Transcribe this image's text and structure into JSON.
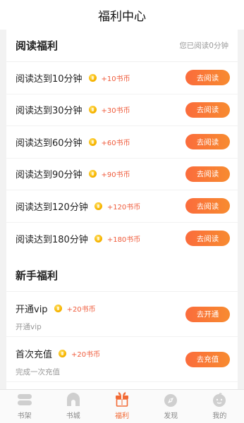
{
  "header": {
    "title": "福利中心"
  },
  "reading": {
    "title": "阅读福利",
    "note": "您已阅读0分钟",
    "items": [
      {
        "label": "阅读达到10分钟",
        "reward": "+10书币",
        "button": "去阅读"
      },
      {
        "label": "阅读达到30分钟",
        "reward": "+30书币",
        "button": "去阅读"
      },
      {
        "label": "阅读达到60分钟",
        "reward": "+60书币",
        "button": "去阅读"
      },
      {
        "label": "阅读达到90分钟",
        "reward": "+90书币",
        "button": "去阅读"
      },
      {
        "label": "阅读达到120分钟",
        "reward": "+120书币",
        "button": "去阅读"
      },
      {
        "label": "阅读达到180分钟",
        "reward": "+180书币",
        "button": "去阅读"
      }
    ]
  },
  "newbie": {
    "title": "新手福利",
    "items": [
      {
        "label": "开通vip",
        "reward": "+20书币",
        "sub": "开通vip",
        "button": "去开通"
      },
      {
        "label": "首次充值",
        "reward": "+20书币",
        "sub": "完成一次充值",
        "button": "去充值"
      }
    ]
  },
  "tabbar": {
    "tabs": [
      {
        "label": "书架",
        "icon": "bookshelf-icon"
      },
      {
        "label": "书城",
        "icon": "bookstore-icon"
      },
      {
        "label": "福利",
        "icon": "gift-icon"
      },
      {
        "label": "发现",
        "icon": "discover-icon"
      },
      {
        "label": "我的",
        "icon": "profile-icon"
      }
    ],
    "active": "福利"
  },
  "colors": {
    "accent": "#f26a35",
    "button_start": "#fb6c3c",
    "button_end": "#f78b30",
    "reward": "#ef5b3b",
    "coin": "#f7b500"
  }
}
